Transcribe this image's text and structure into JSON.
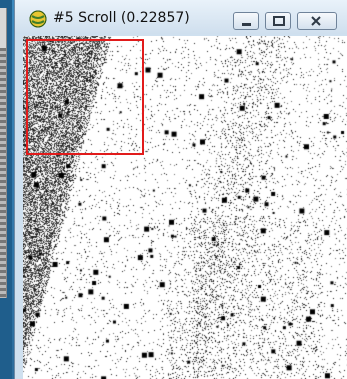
{
  "window": {
    "title": "#5 Scroll (0.22857)"
  },
  "icons": {
    "app": "imagej-globe-icon",
    "minimize": "minimize-icon",
    "maximize": "maximize-icon",
    "close": "close-icon"
  },
  "colors": {
    "roi": "#e11b1b",
    "titlebar": "#dbe8f4"
  }
}
